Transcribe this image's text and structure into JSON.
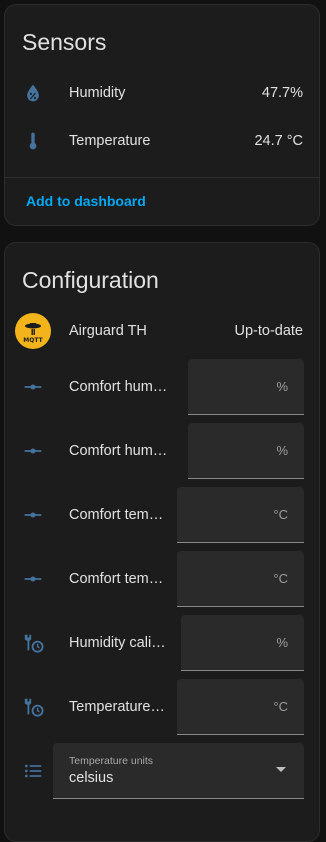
{
  "sensors": {
    "title": "Sensors",
    "rows": [
      {
        "label": "Humidity",
        "value": "47.7%",
        "icon": "water-percent-icon"
      },
      {
        "label": "Temperature",
        "value": "24.7 °C",
        "icon": "thermometer-icon"
      }
    ],
    "add_to_dashboard": "Add to dashboard"
  },
  "configuration": {
    "title": "Configuration",
    "device": {
      "name": "Airguard TH",
      "status": "Up-to-date",
      "badge_text": "MQTT"
    },
    "numbers": [
      {
        "label": "Comfort hum…",
        "unit": "%",
        "value": "",
        "icon": "ray-vertex-icon"
      },
      {
        "label": "Comfort hum…",
        "unit": "%",
        "value": "",
        "icon": "ray-vertex-icon"
      },
      {
        "label": "Comfort tem…",
        "unit": "°C",
        "value": "",
        "icon": "ray-vertex-icon"
      },
      {
        "label": "Comfort tem…",
        "unit": "°C",
        "value": "",
        "icon": "ray-vertex-icon"
      },
      {
        "label": "Humidity cali…",
        "unit": "%",
        "value": "",
        "icon": "wrench-clock-icon"
      },
      {
        "label": "Temperature…",
        "unit": "°C",
        "value": "",
        "icon": "wrench-clock-icon"
      }
    ],
    "select": {
      "label": "Temperature units",
      "value": "celsius",
      "icon": "format-list-bulleted-icon"
    }
  },
  "colors": {
    "background": "#111111",
    "card": "#1c1c1c",
    "icon_blue": "#44739e",
    "link": "#03a9f4",
    "mqtt_yellow": "#f3b41b"
  }
}
